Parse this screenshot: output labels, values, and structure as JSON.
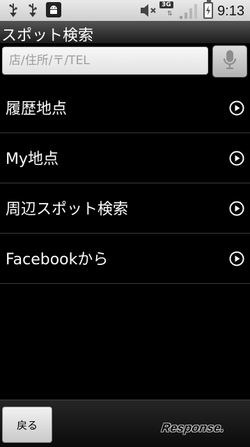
{
  "status_bar": {
    "time": "9:13",
    "network_type": "3G",
    "icons": [
      "usb-icon",
      "usb-icon",
      "android-debug-icon",
      "mute-icon",
      "signal-icon",
      "battery-icon"
    ]
  },
  "title": "スポット検索",
  "search": {
    "placeholder": "店/住所/〒/TEL",
    "value": ""
  },
  "list_items": [
    {
      "label": "履歴地点"
    },
    {
      "label": "My地点"
    },
    {
      "label": "周辺スポット検索"
    },
    {
      "label": "Facebookから"
    }
  ],
  "bottom_bar": {
    "back_label": "戻る",
    "watermark": "Response."
  }
}
